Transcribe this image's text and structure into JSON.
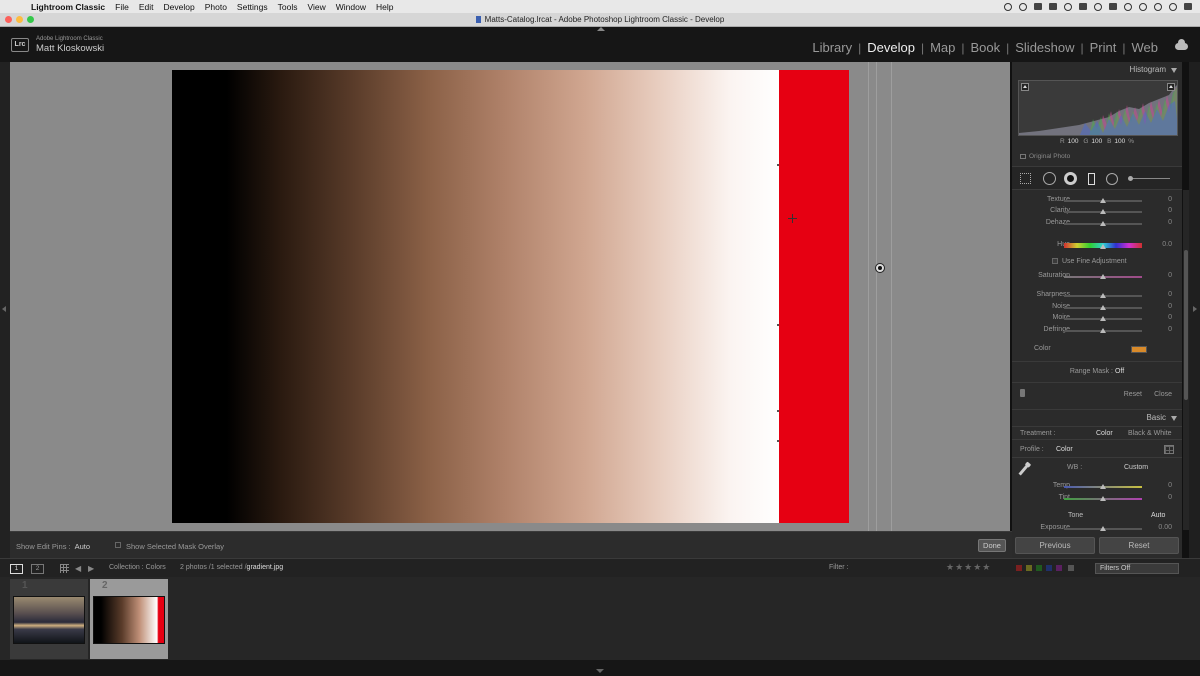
{
  "menubar": {
    "apple_glyph": "",
    "app": "Lightroom Classic",
    "items": [
      "File",
      "Edit",
      "Develop",
      "Photo",
      "Settings",
      "Tools",
      "View",
      "Window",
      "Help"
    ]
  },
  "window": {
    "title": "Matts-Catalog.lrcat - Adobe Photoshop Lightroom Classic - Develop"
  },
  "identity": {
    "logo": "Lrc",
    "app_small": "Adobe Lightroom Classic",
    "user": "Matt Kloskowski"
  },
  "modules": [
    {
      "label": "Library",
      "active": false
    },
    {
      "label": "Develop",
      "active": true
    },
    {
      "label": "Map",
      "active": false
    },
    {
      "label": "Book",
      "active": false
    },
    {
      "label": "Slideshow",
      "active": false
    },
    {
      "label": "Print",
      "active": false
    },
    {
      "label": "Web",
      "active": false
    }
  ],
  "module_separator": "|",
  "toolbar": {
    "show_edit_pins_label": "Show Edit Pins :",
    "show_edit_pins_value": "Auto",
    "mask_overlay_label": "Show Selected Mask Overlay",
    "done_label": "Done"
  },
  "histogram": {
    "title": "Histogram",
    "r_label": "R",
    "r_value": "100",
    "g_label": "G",
    "g_value": "100",
    "b_label": "B",
    "b_value": "100",
    "percent": "%",
    "original_photo": "Original Photo"
  },
  "brush_panel": {
    "sliders_top": [
      {
        "name": "Texture",
        "value": "0",
        "pos": 0.5
      },
      {
        "name": "Clarity",
        "value": "0",
        "pos": 0.5
      },
      {
        "name": "Dehaze",
        "value": "0",
        "pos": 0.5
      }
    ],
    "hue": {
      "name": "Hue",
      "value": "0.0",
      "pos": 0.5
    },
    "fine_adjustment": "Use Fine Adjustment",
    "saturation": {
      "name": "Saturation",
      "value": "0",
      "pos": 0.5
    },
    "sliders_bottom": [
      {
        "name": "Sharpness",
        "value": "0",
        "pos": 0.5
      },
      {
        "name": "Noise",
        "value": "0",
        "pos": 0.5
      },
      {
        "name": "Moire",
        "value": "0",
        "pos": 0.5
      },
      {
        "name": "Defringe",
        "value": "0",
        "pos": 0.5
      }
    ],
    "color_label": "Color",
    "color_swatch": "#d88a2a",
    "range_mask_label": "Range Mask :",
    "range_mask_value": "Off",
    "reset_label": "Reset",
    "close_label": "Close"
  },
  "basic_panel": {
    "title": "Basic",
    "treatment_label": "Treatment :",
    "treatment_color": "Color",
    "treatment_bw": "Black & White",
    "profile_label": "Profile :",
    "profile_value": "Color",
    "wb_label": "WB :",
    "wb_value": "Custom",
    "temp": {
      "name": "Temp",
      "value": "0",
      "pos": 0.5
    },
    "tint": {
      "name": "Tint",
      "value": "0",
      "pos": 0.5
    },
    "tone_label": "Tone",
    "auto_label": "Auto",
    "exposure": {
      "name": "Exposure",
      "value": "0.00",
      "pos": 0.5
    }
  },
  "panel_buttons": {
    "previous": "Previous",
    "reset": "Reset"
  },
  "filmstrip_bar": {
    "screen1": "1",
    "screen2": "2",
    "back_glyph": "◀",
    "forward_glyph": "▶",
    "source": "Collection : Colors",
    "count": "2 photos /1 selected /",
    "filename": "gradient.jpg",
    "filter_label": "Filter :",
    "stars": "★★★★★",
    "filters_value": "Filters Off"
  },
  "thumbnails": [
    {
      "number": "1",
      "subject": "sunset rock landscape"
    },
    {
      "number": "2",
      "subject": "gradient"
    }
  ],
  "colors": {
    "accent_red": "#e60012",
    "menubar": "#e8e8e8",
    "panel": "#2b2b2b",
    "canvas_gray": "#8a8a8a"
  }
}
